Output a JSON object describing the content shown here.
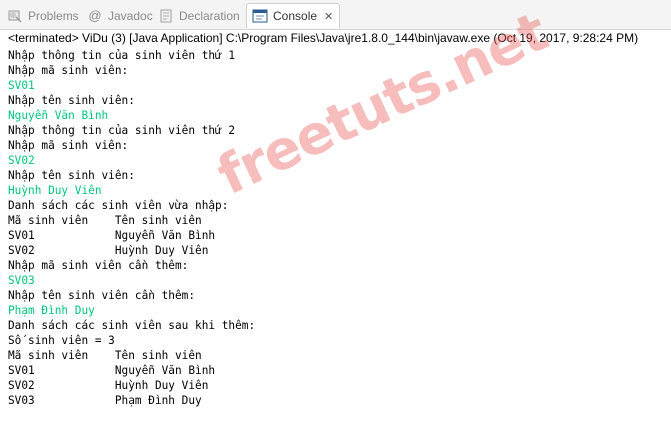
{
  "tabs": [
    {
      "label": "Problems",
      "icon": "problems-icon",
      "active": false
    },
    {
      "label": "Javadoc",
      "icon": "at-sign-icon",
      "active": false
    },
    {
      "label": "Declaration",
      "icon": "declaration-icon",
      "active": false
    },
    {
      "label": "Console",
      "icon": "console-icon",
      "active": true
    }
  ],
  "status": "<terminated> ViDu (3) [Java Application] C:\\Program Files\\Java\\jre1.8.0_144\\bin\\javaw.exe (Oct 19, 2017, 9:28:24 PM)",
  "console_lines": [
    {
      "text": "Nhập thông tin của sinh viên thứ 1",
      "input": false
    },
    {
      "text": "Nhập mã sinh viên:",
      "input": false
    },
    {
      "text": "SV01",
      "input": true
    },
    {
      "text": "Nhập tên sinh viên:",
      "input": false
    },
    {
      "text": "Nguyễn Văn Bình",
      "input": true
    },
    {
      "text": "Nhập thông tin của sinh viên thứ 2",
      "input": false
    },
    {
      "text": "Nhập mã sinh viên:",
      "input": false
    },
    {
      "text": "SV02",
      "input": true
    },
    {
      "text": "Nhập tên sinh viên:",
      "input": false
    },
    {
      "text": "Huỳnh Duy Viên",
      "input": true
    },
    {
      "text": "Danh sách các sinh viên vừa nhập:",
      "input": false
    },
    {
      "text": "Mã sinh viên    Tên sinh viên",
      "input": false
    },
    {
      "text": "SV01            Nguyễn Văn Bình",
      "input": false
    },
    {
      "text": "SV02            Huỳnh Duy Viên",
      "input": false
    },
    {
      "text": "Nhập mã sinh viên cần thêm:",
      "input": false
    },
    {
      "text": "SV03",
      "input": true
    },
    {
      "text": "Nhập tên sinh viên cần thêm:",
      "input": false
    },
    {
      "text": "Phạm Đình Duy",
      "input": true
    },
    {
      "text": "Danh sách các sinh viên sau khi thêm:",
      "input": false
    },
    {
      "text": "Số sinh viên = 3",
      "input": false
    },
    {
      "text": "Mã sinh viên    Tên sinh viên",
      "input": false
    },
    {
      "text": "SV01            Nguyễn Văn Bình",
      "input": false
    },
    {
      "text": "SV02            Huỳnh Duy Viên",
      "input": false
    },
    {
      "text": "SV03            Phạm Đình Duy",
      "input": false
    }
  ],
  "watermark": "freetuts.net",
  "colors": {
    "input_text": "#00c87d",
    "watermark": "#eb5858",
    "console_tab_icon": "#2a5d8f"
  }
}
